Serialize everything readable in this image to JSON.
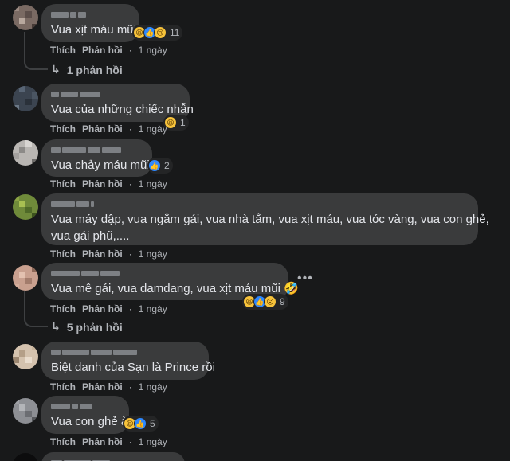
{
  "actions": {
    "like": "Thích",
    "reply": "Phản hồi",
    "dot": "·"
  },
  "colors": {
    "background": "#18191a",
    "bubble": "#3a3b3c",
    "secondary_text": "#b0b3b8",
    "primary_text": "#e4e6eb",
    "like_blue": "#2d88ff",
    "emoji_yellow": "#f7c33b"
  },
  "comments": [
    {
      "text": "Vua xịt máu mũi",
      "time": "1 ngày",
      "reactions": [
        "haha",
        "like",
        "sad"
      ],
      "reaction_count": "11",
      "replies": "1 phản hồi"
    },
    {
      "text": "Vua của những chiếc nhẫn",
      "time": "1 ngày",
      "reactions": [
        "haha"
      ],
      "reaction_count": "1"
    },
    {
      "text": "Vua chảy máu mũi",
      "time": "1 ngày",
      "reactions": [
        "like"
      ],
      "reaction_count": "2"
    },
    {
      "text_line1": "Vua máy dập, vua ngắm gái, vua nhà tắm, vua xịt máu, vua tóc vàng, vua con ghẻ,",
      "text_line2": "vua gái phũ,....",
      "time": "1 ngày"
    },
    {
      "text": "Vua mê gái, vua damdang, vua xịt máu mũi 🤣",
      "time": "1 ngày",
      "reactions": [
        "haha",
        "like",
        "wow"
      ],
      "reaction_count": "9",
      "replies": "5 phản hồi"
    },
    {
      "text": "Biệt danh của Sạn là Prince rồi",
      "time": "1 ngày"
    },
    {
      "text": "Vua con ghẻ à",
      "time": "1 ngày",
      "reactions": [
        "haha",
        "like"
      ],
      "reaction_count": "5"
    }
  ]
}
